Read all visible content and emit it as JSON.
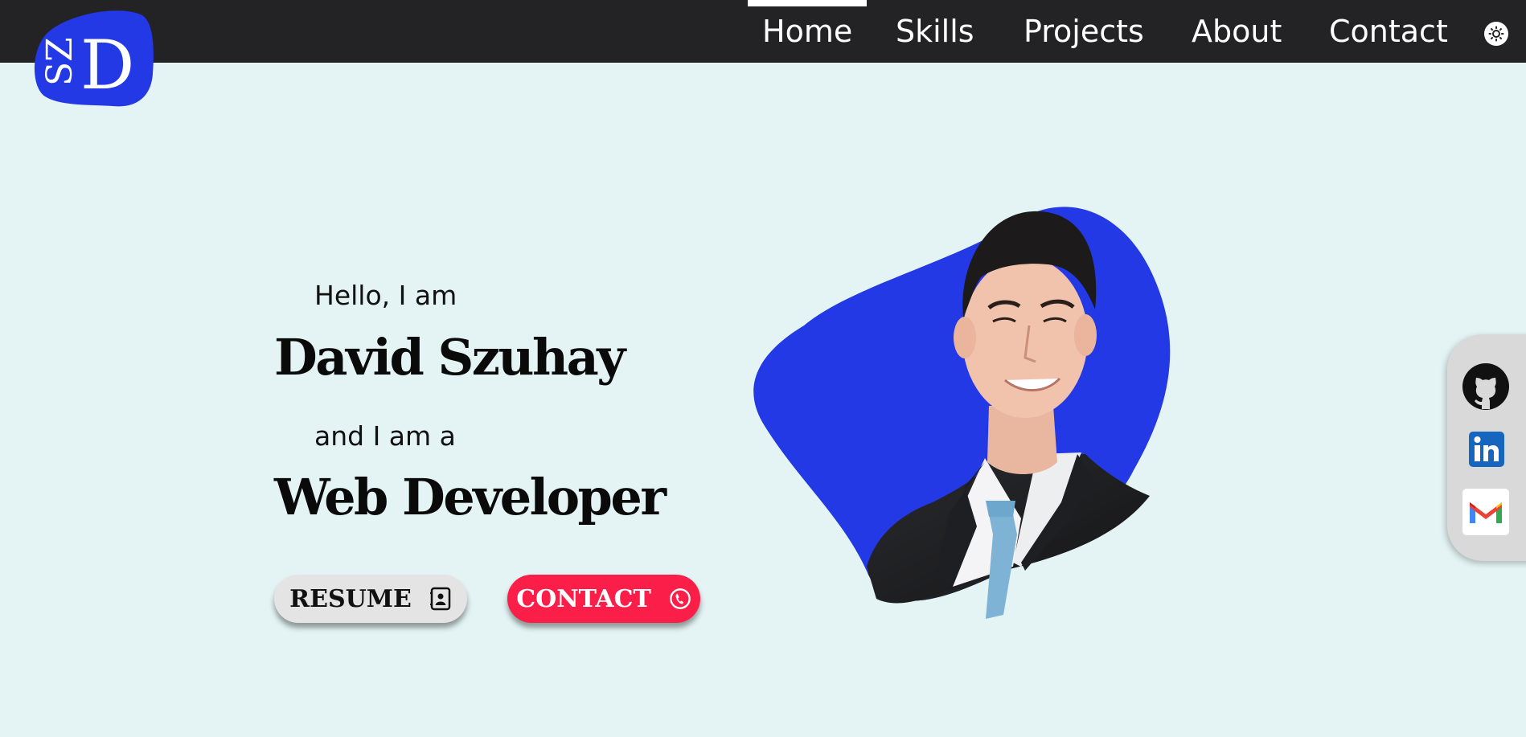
{
  "logo": {
    "text_top": "SZ",
    "text_main": "D"
  },
  "nav": {
    "items": [
      {
        "label": "Home",
        "active": true
      },
      {
        "label": "Skills",
        "active": false
      },
      {
        "label": "Projects",
        "active": false
      },
      {
        "label": "About",
        "active": false
      },
      {
        "label": "Contact",
        "active": false
      }
    ],
    "theme_toggle_icon": "sun-icon"
  },
  "hero": {
    "greeting": "Hello, I am",
    "name": "David Szuhay",
    "intro": "and I am a",
    "role": "Web Developer",
    "buttons": {
      "resume": {
        "label": "RESUME",
        "icon": "contact-card-icon"
      },
      "contact": {
        "label": "CONTACT",
        "icon": "phone-icon"
      }
    }
  },
  "social": {
    "links": [
      {
        "name": "GitHub",
        "icon": "github-icon"
      },
      {
        "name": "LinkedIn",
        "icon": "linkedin-icon"
      },
      {
        "name": "Gmail",
        "icon": "gmail-icon"
      }
    ]
  },
  "colors": {
    "background": "#e4f4f4",
    "navbar": "#232224",
    "accent_blue": "#2339e6",
    "contact_button": "#fb1e48",
    "resume_button": "#e4e4e4",
    "social_panel": "#d9d9d9"
  }
}
